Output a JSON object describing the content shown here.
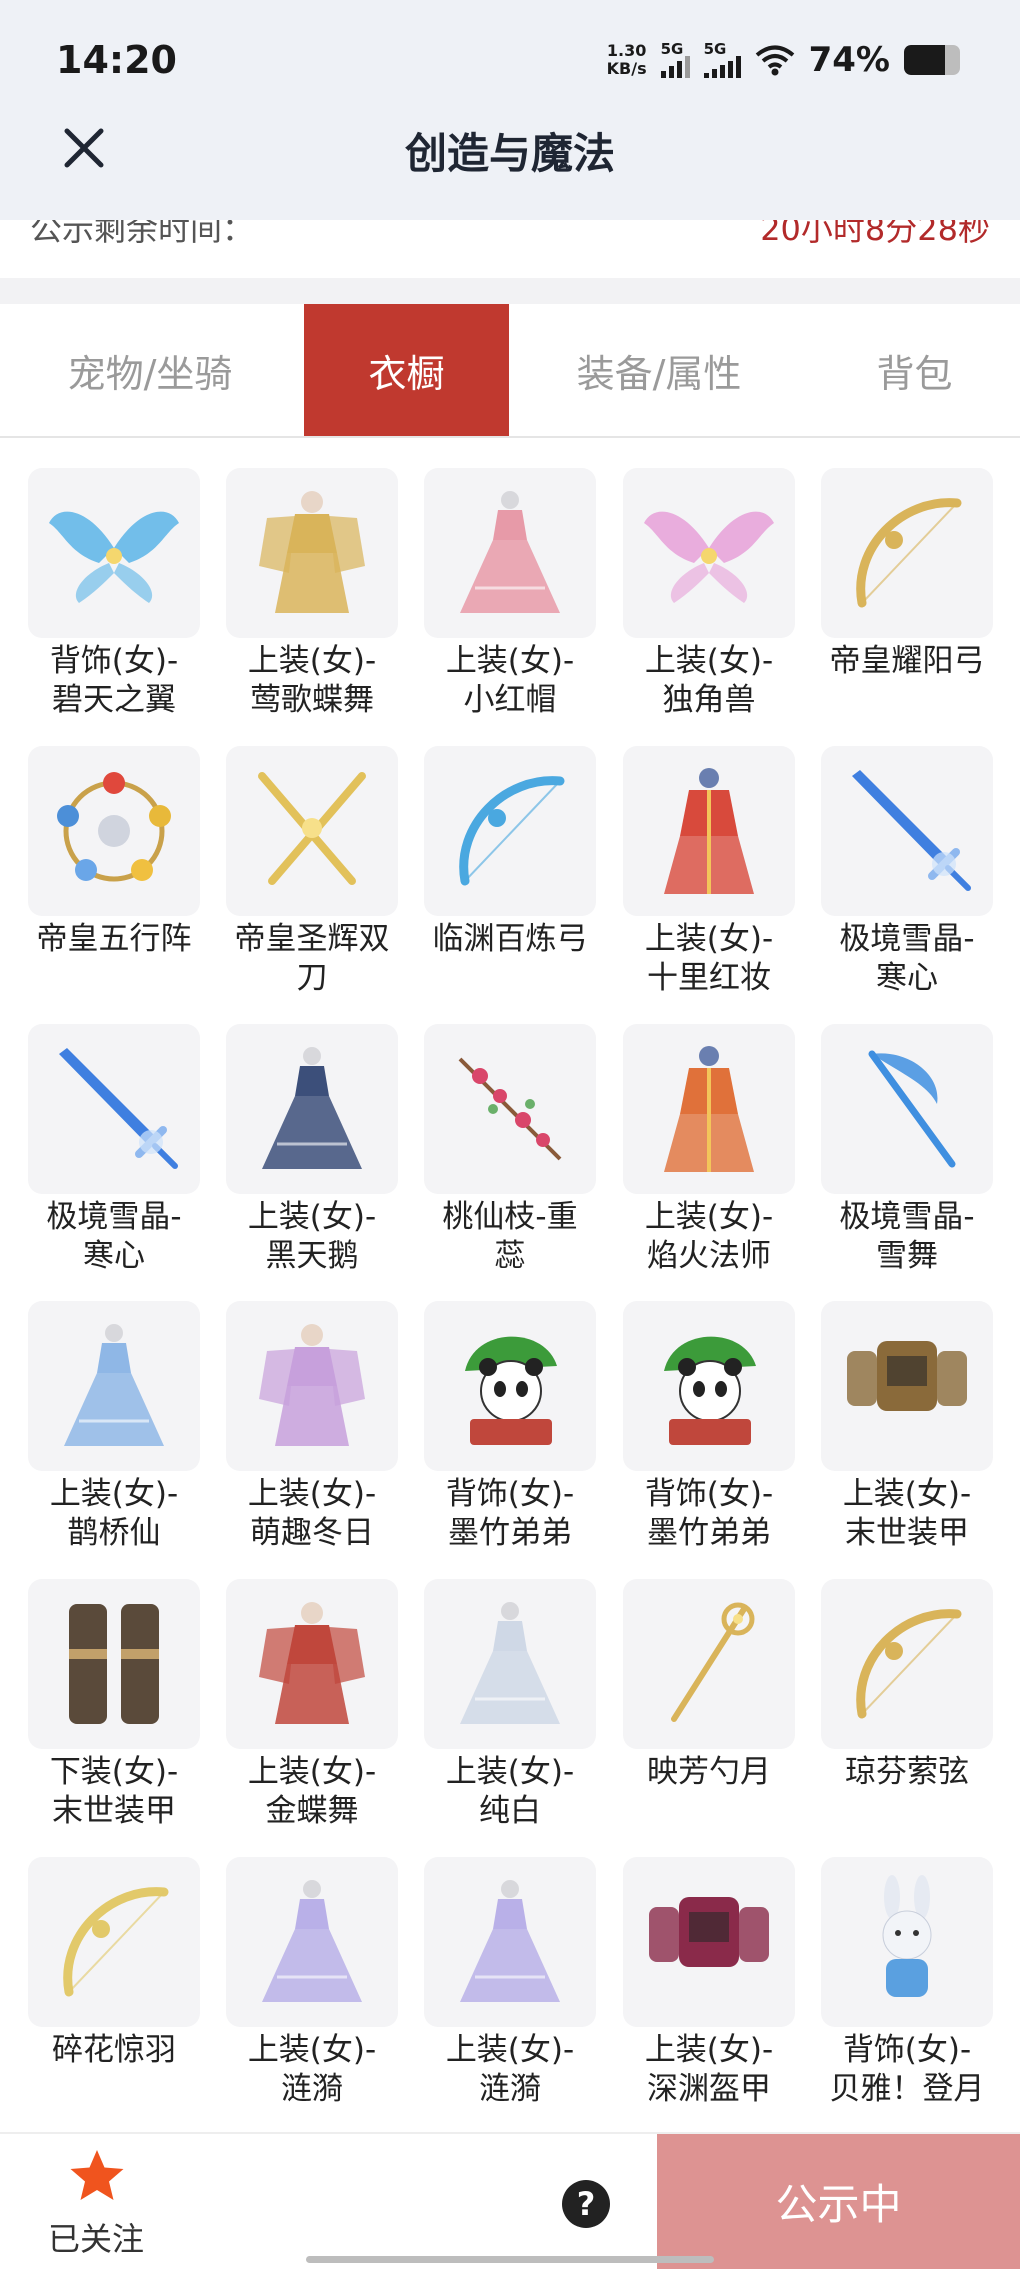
{
  "status_bar": {
    "time": "14:20",
    "net_speed": "1.30",
    "net_unit": "KB/s",
    "sim1": "5G",
    "sim2": "5G",
    "battery": "74%"
  },
  "header": {
    "title": "创造与魔法"
  },
  "notice": {
    "label": "公示剩余时间：",
    "value": "20小时8分28秒"
  },
  "tabs": [
    {
      "label": "宠物/坐骑",
      "active": false
    },
    {
      "label": "衣橱",
      "active": true
    },
    {
      "label": "装备/属性",
      "active": false
    },
    {
      "label": "背包",
      "active": false
    }
  ],
  "items": [
    {
      "line1": "背饰(女)-",
      "line2": "碧天之翼",
      "icon": "wings-icon",
      "color": "#5ab4e8"
    },
    {
      "line1": "上装(女)-",
      "line2": "莺歌蝶舞",
      "icon": "costume-icon",
      "color": "#d9b45a"
    },
    {
      "line1": "上装(女)-",
      "line2": "小红帽",
      "icon": "dress-icon",
      "color": "#e79aa8"
    },
    {
      "line1": "上装(女)-",
      "line2": "独角兽",
      "icon": "wings-icon",
      "color": "#e6a0d8"
    },
    {
      "line1": "帝皇耀阳弓",
      "line2": "",
      "icon": "bow-icon",
      "color": "#d9b45a"
    },
    {
      "line1": "帝皇五行阵",
      "line2": "",
      "icon": "orb-ring-icon",
      "color": "#c9a14a"
    },
    {
      "line1": "帝皇圣辉双",
      "line2": "刀",
      "icon": "twin-blades-icon",
      "color": "#e2c15a"
    },
    {
      "line1": "临渊百炼弓",
      "line2": "",
      "icon": "bow-icon",
      "color": "#4aa8e0"
    },
    {
      "line1": "上装(女)-",
      "line2": "十里红妆",
      "icon": "robe-icon",
      "color": "#d84a3c"
    },
    {
      "line1": "极境雪晶-",
      "line2": "寒心",
      "icon": "sword-icon",
      "color": "#3f7fe0"
    },
    {
      "line1": "极境雪晶-",
      "line2": "寒心",
      "icon": "sword-icon",
      "color": "#3f7fe0"
    },
    {
      "line1": "上装(女)-",
      "line2": "黑天鹅",
      "icon": "dress-icon",
      "color": "#3c4f7a"
    },
    {
      "line1": "桃仙枝-重",
      "line2": "蕊",
      "icon": "branch-icon",
      "color": "#d9466a"
    },
    {
      "line1": "上装(女)-",
      "line2": "焰火法师",
      "icon": "robe-icon",
      "color": "#e0713a"
    },
    {
      "line1": "极境雪晶-",
      "line2": "雪舞",
      "icon": "scythe-icon",
      "color": "#3f8fe0"
    },
    {
      "line1": "上装(女)-",
      "line2": "鹊桥仙",
      "icon": "dress-icon",
      "color": "#8fb7e6"
    },
    {
      "line1": "上装(女)-",
      "line2": "萌趣冬日",
      "icon": "costume-icon",
      "color": "#c7a0dc"
    },
    {
      "line1": "背饰(女)-",
      "line2": "墨竹弟弟",
      "icon": "panda-icon",
      "color": "#3c9b3a"
    },
    {
      "line1": "背饰(女)-",
      "line2": "墨竹弟弟",
      "icon": "panda-icon",
      "color": "#3c9b3a"
    },
    {
      "line1": "上装(女)-",
      "line2": "末世装甲",
      "icon": "armor-icon",
      "color": "#8a6a3a"
    },
    {
      "line1": "下装(女)-",
      "line2": "末世装甲",
      "icon": "armor-legs-icon",
      "color": "#5a4a3a"
    },
    {
      "line1": "上装(女)-",
      "line2": "金蝶舞",
      "icon": "costume-icon",
      "color": "#c0473c"
    },
    {
      "line1": "上装(女)-",
      "line2": "纯白",
      "icon": "dress-icon",
      "color": "#cfd8e6"
    },
    {
      "line1": "映芳勺月",
      "line2": "",
      "icon": "staff-icon",
      "color": "#d9b45a"
    },
    {
      "line1": "琼芬萦弦",
      "line2": "",
      "icon": "bow-icon",
      "color": "#d9b45a"
    },
    {
      "line1": "碎花惊羽",
      "line2": "",
      "icon": "bow-icon",
      "color": "#e2c96a"
    },
    {
      "line1": "上装(女)-",
      "line2": "涟漪",
      "icon": "dress-icon",
      "color": "#b9b0e8"
    },
    {
      "line1": "上装(女)-",
      "line2": "涟漪",
      "icon": "dress-icon",
      "color": "#b9b0e8"
    },
    {
      "line1": "上装(女)-",
      "line2": "深渊盔甲",
      "icon": "armor-icon",
      "color": "#8a2a4a"
    },
    {
      "line1": "背饰(女)-",
      "line2": "贝雅！登月",
      "icon": "bunny-icon",
      "color": "#5aa0e0"
    }
  ],
  "bottom": {
    "follow_label": "已关注",
    "help": "?",
    "status_button": "公示中",
    "star_color": "#f0541e"
  }
}
